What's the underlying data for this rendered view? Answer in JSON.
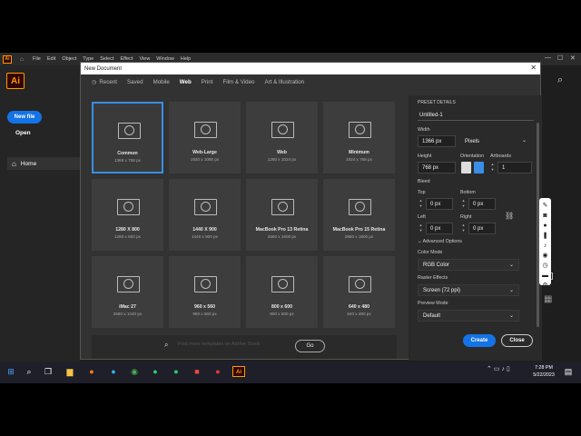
{
  "menubar": {
    "app_icon": "Ai",
    "items": [
      "File",
      "Edit",
      "Object",
      "Type",
      "Select",
      "Effect",
      "View",
      "Window",
      "Help"
    ]
  },
  "sidebar": {
    "logo": "Ai",
    "new_file": "New file",
    "open": "Open",
    "home": "Home"
  },
  "dialog": {
    "title": "New Document",
    "tabs": [
      "Recent",
      "Saved",
      "Mobile",
      "Web",
      "Print",
      "Film & Video",
      "Art & Illustration"
    ],
    "active_tab": "Web",
    "presets": [
      {
        "name": "Common",
        "size": "1366 x 768 px",
        "selected": true
      },
      {
        "name": "Web-Large",
        "size": "1920 x 1080 px"
      },
      {
        "name": "Web",
        "size": "1280 x 1024 px"
      },
      {
        "name": "Minimum",
        "size": "1024 x 768 px"
      },
      {
        "name": "1280 X 800",
        "size": "1280 x 800 px"
      },
      {
        "name": "1440 X 900",
        "size": "1440 x 900 px"
      },
      {
        "name": "MacBook Pro 13 Retina",
        "size": "2560 x 1600 px"
      },
      {
        "name": "MacBook Pro 15 Retina",
        "size": "2880 x 1800 px"
      },
      {
        "name": "iMac 27",
        "size": "2560 x 1440 px"
      },
      {
        "name": "960 x 560",
        "size": "960 x 560 px"
      },
      {
        "name": "800 x 600",
        "size": "800 x 600 px"
      },
      {
        "name": "640 x 480",
        "size": "640 x 480 px"
      }
    ],
    "search_placeholder": "Find more templates on Adobe Stock",
    "go": "Go",
    "create": "Create",
    "close": "Close"
  },
  "preset_details": {
    "heading": "PRESET DETAILS",
    "name": "Untitled-1",
    "width_label": "Width",
    "width": "1366 px",
    "units": "Pixels",
    "height_label": "Height",
    "height": "768 px",
    "orientation_label": "Orientation",
    "artboards_label": "Artboards",
    "artboards": "1",
    "bleed_label": "Bleed",
    "top_label": "Top",
    "top": "0 px",
    "bottom_label": "Bottom",
    "bottom": "0 px",
    "left_label": "Left",
    "left": "0 px",
    "right_label": "Right",
    "right": "0 px",
    "advanced": "Advanced Options",
    "color_mode_label": "Color Mode",
    "color_mode": "RGB Color",
    "raster_label": "Raster Effects",
    "raster": "Screen (72 ppi)",
    "preview_label": "Preview Mode",
    "preview": "Default"
  },
  "taskbar": {
    "time": "7:28 PM",
    "date": "5/22/2023"
  },
  "colors": {
    "accent": "#1473e6",
    "selected_border": "#3a8ee6",
    "ai_orange": "#ff9a00"
  }
}
